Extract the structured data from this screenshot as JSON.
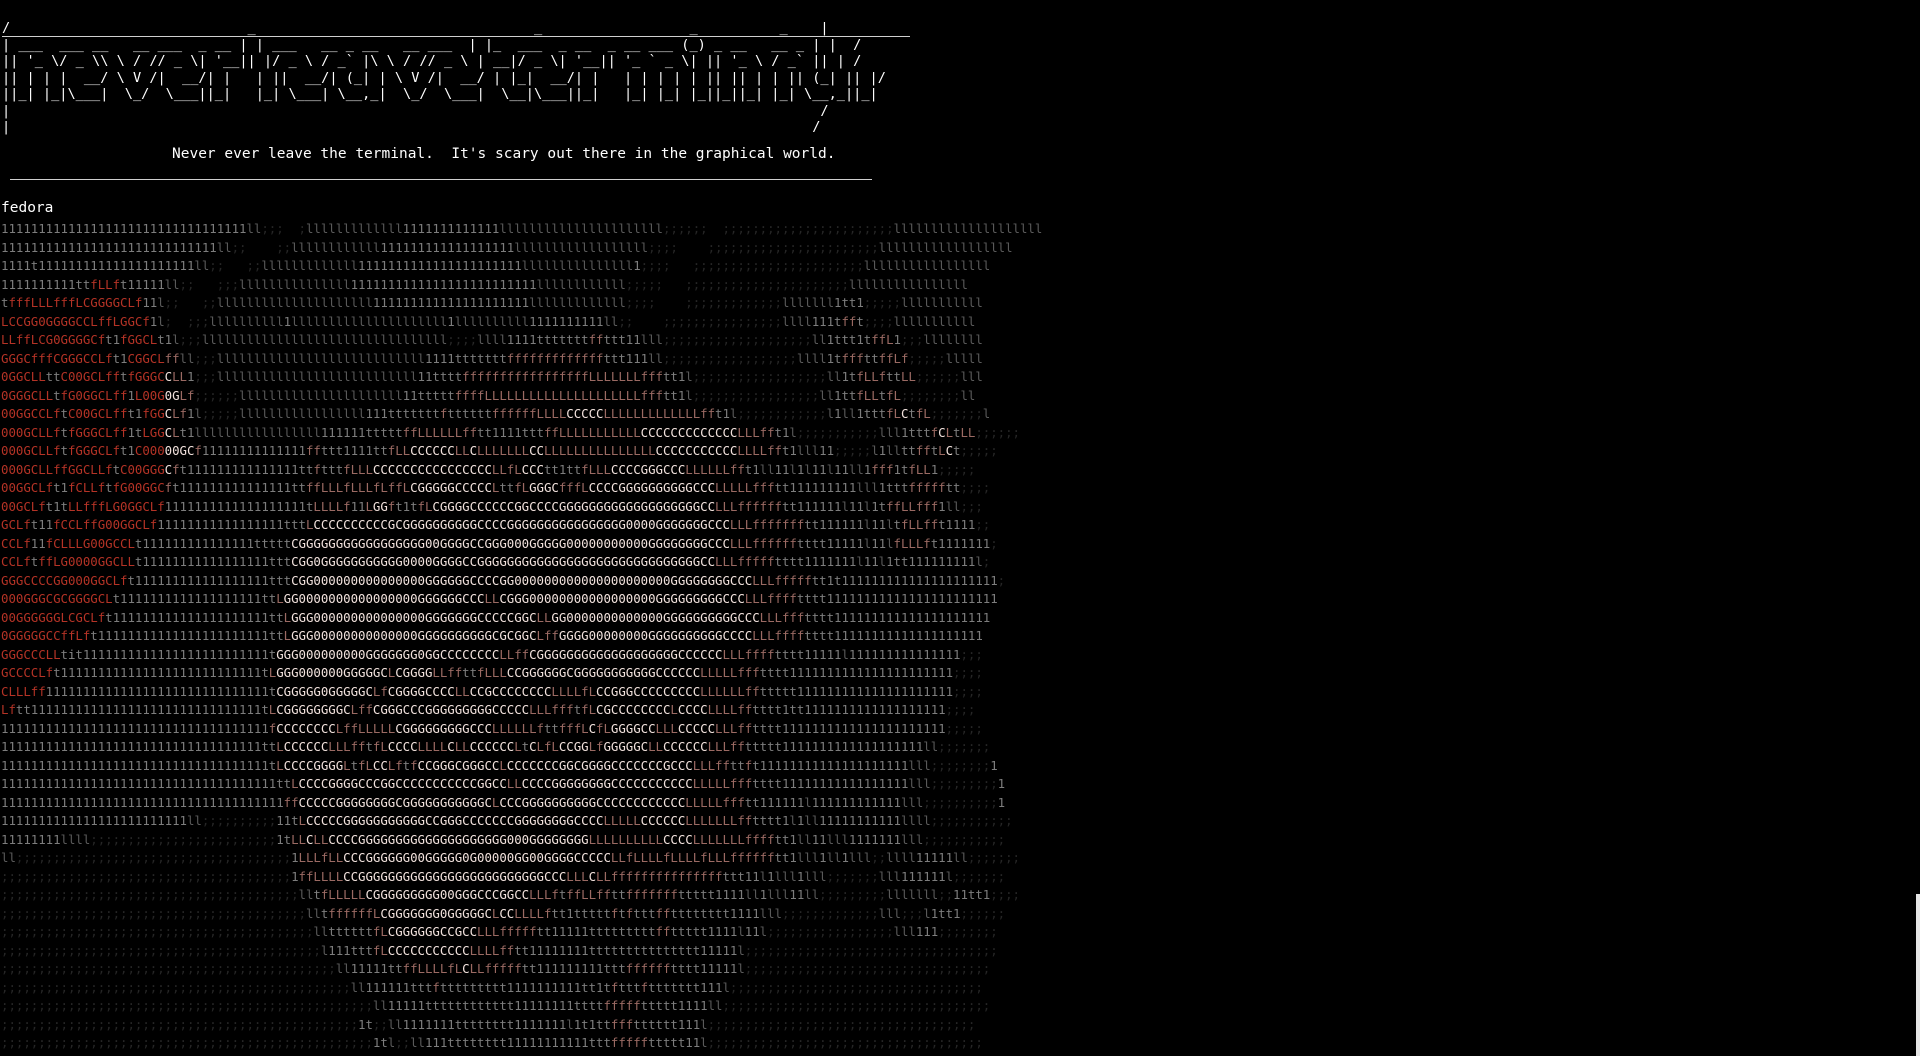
{
  "banner": {
    "art_lines": [
      " ____________________________________________________________________________________________________ ",
      "/                             _                                  _                  _          _    |",
      "| ___  ___ __   __ ___  _ __ | | ___   __ _ __   __ ___  | |_  ___  _ __  _ __ ___ (_) _ __   __ _ | |  /",
      "|| '_ \\/ _ \\\\ \\ / // _ \\| '__|| |/ _ \\ / _` |\\ \\ / // _ \\ | __|/ _ \\| '__|| '_ ` _ \\| || '_ \\ / _` || | / ",
      "|| | | |  __/ \\ V /|  __/| |   | ||  __/| (_| | \\ V /|  __/ | |_|  __/| |   | | | | | || || | | || (_| || |/  ",
      "||_| |_|\\___|  \\_/  \\___||_|   |_| \\___| \\__,_|  \\_/  \\___|  \\__|\\___||_|   |_| |_| |_||_||_| |_| \\__,_||_|   ",
      "|                                                                                                   /   ",
      "|                                                                                                  /    ",
      "|__________________________________________________________________________________________________/     "
    ],
    "tagline": "Never ever leave the terminal.  It's scary out there in the graphical world."
  },
  "hostname": "fedora",
  "ascii_art": {
    "description_free": true,
    "palette": {
      "bright": "#f2e2dd",
      "red": "#b53326",
      "dim": "#5a5a5a",
      "faint": "#262626"
    },
    "rows": [
      "111111111111111111111111111111111ll;;;  ;lllllllllllll1111111111111llllllllllllllllllllll;;;;;;  ;;;;;;;;;;;;;;;;;;;;;;;llllllllllllllllllll",
      "11111111111111111111111111111ll;;    ;;llllllllllll111111111111111111llllllllllllllllll;;;;    ;;;;;;;;;;;;;;;;;;;;;;;llllllllllllllllll",
      "1111t111111111111111111111ll;;   ;;lllllllllllll1111111111111111111111lllllllllllllll1;;;;   ;;;;;;;;;;;;;;;;;;;;;;;lllllllllllllllll",
      "1111111111ttfLLft11111ll;;   ;;;lllllllllllllll1111111111111111111111111llllllllllll;;;;;   ;;;;;;;;;;;;;;;;;;;;;;llllllllllllllll",
      "tfffLLLfffLCGGGGCLf11l;;   ;;lllllllllllllllllllll111111111111111111111lllllllllllll;;;;    ;;;;;;;;;;;;;lllllll1tt1;;;;;lllllllllll",
      "LCCGG0GGGGCCLffLGGCf1l;  ;;;llllllllll1lllllllllllllllllllll1llllllllll1111111111ll;;    ;;;;;;;;;;;;;;;;llll111tfft;;;;lllllllllll",
      "LLffLCG0GGGGCft1fGGCLt1l;;;lllllllllllllllllllllllllllllllll;;;;llll1111tttttttffttt11lll;;;;;;;;;;;;;;;;;;;;ll1ttt1tffL1;;;llllllll",
      "GGGCfffCGGGCCLft1CGGCLffll;;;llllllllllllllllllllllllllll1111tttttttfffffffffffffttt111ll;;;;;;;;;;;;;;;;;;llll1tfffttffLf;;;;;lllll",
      "0GGCLLttC00GCLfftfGGGCCLL1;;;lllllllllllllllllllllllllll11ttttfffffffffffffffffLLLLLLLffftt1l;;;;;;;;;;;;;;;;;;ll1tfLLfttLL;;;;;;lll",
      "0GGGCLLtfG0GGCLff1L00G0GLf;;;;;;llllllllllllllllllllll11tttttffffLLLLLLLLLLLLLLLLLLLLLffftt1l;;;;;;;;;;;;;;;;;ll1ttfLLtfL;;;;;;;;ll",
      "00GGCCLftC00GCLfft1fGGCLf1l;;;;;lllllllllllllllll111tttttttfttttttffffffLLLLCCCCCLLLLLLLLLLLLLfft1l;;;;;;;;;;;;l1ll1tttfLCtfL;;;;;;;l",
      "000GCLLftfGGGCLff1tLGGCLt1lllllllllllllllll111111tttttffLLLLLLfftt1111tttffLLLLLLLLLLLCCCCCCCCCCCCCLLLfft1l;;;;;;;;;;;lll1tttfCLtLL;;;;;;",
      "000GCLLftfGGGCLft1C00000GCf11111111111111ffttt1111ttfLLCCCCCCLLCLLLLLLLCCLLLLLLLLLLLLLLLCCCCCCCCCCCLLLLfft1lll11;;;;;l1llttfftLCt;;;;;",
      "000GCLLffGGCLLftC00GGGCft111111111111111ttftttfLLLCCCCCCCCCCCCCCCCLLfLCCCtt1ttfLLLCCCCGGGCCCLLLLLLfft1ll11l1l11l11ll1fff1tfLL1;;;;;",
      "00GGCLft1fCLLftfG00GGCft111111111111111ttffLLLfLLLfLffLCGGGGGCCCCCLttfLGGGCfffLCCCCGGGGGGGGGGCCCLLLLLffftt111111111lll1tttffffftt;;;;",
      "00GCLft1tLLfffLG0GGCLf1111111111111111111tLLLLf11LGGft1tfLCGGGGCCCCCCGGCCCCGGGGGGGGGGGGGGGGGGGCCLLLfffffftt111111l11l1tffLLfff1ll;;;",
      "GCLft11fCCLffG00GGCLf11111111111111111tttLCCCCCCCCCCGCGGGGGGGGGGCCCCGGGGGGGGGGGGGGGG0000GGGGGGGCCCLLLffffffftt111111l11ltfLLfft1111;;",
      "CCLf11fCLLLG00GCCLt111111111111111tttttCGGGGGGGGGGGGGGGGG00GGGGCCGGG000GGGGG00000000000GGGGGGGGCCCLLLfffffftttt11111l11lfLLLft1111111;",
      "CCLftffLG0000GGCLLt11111111111111111tttCGG0GGGGGGGGGGG0000GGGGCCGGGGGGGGGGGGGGGGGGGGGGGGGGGGGGCCLLLffffftttt1111111l11l1tt111111111l;",
      "GGGCCCCGG000GGCLft111111111111111111tttCGG000000000000000GGGGGGCCCCGG000000000000000000000GGGGGGGGCCCLLLffffftt1t111111111111111111111;",
      "000GGGCGCGGGGCLt1111111111111111111ttLGG0000000000000000GGGGGGCCCLLCGGG00000000000000000GGGGGGGGGCCCLLLfffftttt11111111111111111111111",
      "00GGGGGGLCGCLft111111111111111111111ttLGGG000000000000000GGGGGGGCCCCCGGCLLGG0000000000000GGGGGGGGGGCCCLLLffftttt111111111111111111111",
      "0GGGGGCCffLft11111111111111111111111ttLGGG00000000000000GGGGGGGGGGCGCGGCLffGGGG00000000GGGGGGGGGGCCCCLLLfffftttt11111111111111111111",
      "GGGCCCLLtit1111111111111111111111111tGGG000000000GGGGGGG0GGCCCCCCCCLLffCGGGGGGGGGGGGGGGGGGGCCCCCCLLLfffftttt11111l111111111111111;;;",
      "GCCCCLft111111111111111111111111111tLGGG000000GGGGGCLCGGGGLLffttfLLLCCGGGGGGCGGGGGGGGGGGCCCCCCLLLLLffftttt1111111111111111111111;;;;",
      "CLLLff111111111111111111111111111111tCGGGGG0GGGGGCLfCGGGGCCCCLLCCGCCCCCCCCLLLLfLCCGGGCCCCCCCCCLLLLLLffttttt111111111111111111111;;;;",
      "Lftt1111111111111111111111111111111tLCGGGGGGGGCLffCGGGCCCGGGGGGGGGCCCCCLLLffftfLCGCCCCCCCCLCCCCLLLLfftttt1tt1111111111111111111;;;;",
      "111111111111111111111111111111111111fCCCCCCCCLffLLLLLCGGGGGGGGGCCCLLLLLLfttfffLCfLGGGGCCLLLCCCCCLLLfftttt1111111111111111111111;;;;;",
      "11111111111111111111111111111111111ttLCCCCCCLLLfftfLCCCCLLLLCLLCCCCCCLtCLfLCCGGLfGGGGGCLLCCCCCCLLLffttttt1111111111111111111ll;;;;;;;",
      "111111111111111111111111111111111111tLCCCCGGGGLtfLCCLftfCCGGGCGGGCCLCCCCCCCGGCGGGGCCCCCCCGCCCLLLffttft11111111111111111111lll;;;;;;;;1",
      "1111111111111111111111111111111111111ttLCCCCGGGGCCCGGCCCCCCCCCCCGGCCLLCCCCGGGGGGGGCCCCCCCCCCCLLLLLffftttt11111111111111111lll;;;;;;;;;1",
      "11111111111111111111111111111111111111ffCCCCCGGGGGGGGCGGGGGGGGGGGCLCCCGGGGGGGGGGCCCCCCCCCCCCLLLLLffftt111111l111111111111lll;;;;;;;;;;1",
      "1111111111111111111111111ll;;;;;;;;;;11tLCCCCCGGGGGGGGGGGCCGGGCCCCCCCGGGGGGGGCCCCLLLLLCCCCCCLLLLLLLfftttt1l1ll11111111111llll;;;;;;;;;;;",
      "11111111llll;;;;;;;;;;;;;;;;;;;;;;;;;1tLLCLLCCCCGGGGGGGGGGGGGGGGGGGG000GGGGGGGGLLLLLLLLLLCCCCLLLLLLLfffftt1ll11lll1111111lll;;;;;;;;;;;",
      "ll;;;;;;;;;;;;;;;;;;;;;;;;;;;;;;;;;;;;;1LLLfLLCCCGGGGGG00GGGGG0G00000GG00GGGGCCCCCLLfLLLLfLLLLfLLLfffffftt1lll1ll1lll;;llll11111ll;;;;;;;",
      ";;;;;;;;;;;;;;;;;;;;;;;;;;;;;;;;;;;;;;;1ffLLLLCCGGGGGGGGGGGGGGGGGGGGGGGGGCCCLLLCLLfffffffffffffffttt11l1lll1lll;;;;;;;lll111111l;;;;;;;",
      ";;;;;;;;;;;;;;;;;;;;;;;;;;;;;;;;;;;;;;;;lltfLLLLLCGGGGGGGGG00GGGCCCGGCCLLLftffLLffttfffffffttttt1111ll1lll11ll;;;;;;;;;lllllll;;11tt1;;;;",
      ";;;;;;;;;;;;;;;;;;;;;;;;;;;;;;;;;;;;;;;;;lltffffffLCGGGGGGG0GGGGGCLCCLLLLftt1tttttftftttfftttttttt1111lll;;;;;;;;;;;;;lll;;;l1tt1;;;;;;",
      ";;;;;;;;;;;;;;;;;;;;;;;;;;;;;;;;;;;;;;;;;;llttttttfLCGGGGGGCCGCCLLLffffftt11111tttttttttffttttt1111l11l;;;;;;;;;;;;;;;;;lll111;;;;;;;;",
      ";;;;;;;;;;;;;;;;;;;;;;;;;;;;;;;;;;;;;;;;;;;l111tttfLCCCCCCCCCCCLLLLfftt11111111ttttttttttttttt11111l;;;;;;;;;;;;;;;;;;;;;;;;;;;;;;;;;;",
      ";;;;;;;;;;;;;;;;;;;;;;;;;;;;;;;;;;;;;;;;;;;;;ll11111ttffLLLLfLCLLffffftt111111111tttfffffftttt11111l;;;;;;;;;;;;;;;;;;;;;;;;;;;;;;;;;",
      ";;;;;;;;;;;;;;;;;;;;;;;;;;;;;;;;;;;;;;;;;;;;;;;ll111111tttfttttttttt1111111111tt1tftttfttttttt111l;;;;;;;;;;;;;;;;;;;;;;;;;;;;;;;;;;",
      ";;;;;;;;;;;;;;;;;;;;;;;;;;;;;;;;;;;;;;;;;;;;;;;;;;ll11111tttttttttttt11111111ttttfffffttttt1111ll;;;;;;;;;;;;;;;;;;;;;;;;;;;;;;;;;;;;",
      ";;;;;;;;;;;;;;;;;;;;;;;;;;;;;;;;;;;;;;;;;;;;;;;;1t;;ll1111111tttttttt1111111l1t1ttffftttttt111l;;;;;;;;;;;;;;;;;;;;;;;;;;;;;;;;;;;;",
      ";;;;;;;;;;;;;;;;;;;;;;;;;;;;;;;;;;;;;;;;;;;;;;;;;;1tl;;ll111tttttttt11111111111tttfffffttttt11l;;;;;;;;;;;;;;;;;;;;;;;;;;;;;;;;;;;;;",
      ";;;;;;;;;;;;;;;;;;;;;;;;;;;;;;;;;;;;;;;;;;;;;;;;;;;;;;;;;;;111tttttfffttffttttttttffttttttt1111ll;;;;;;;;;;;;;;;;;;;;;;;;;;;;;;;;;;;;",
      ";;;;;;;;;;;;;;;;;;;;;;;;;;;;;;;;;;;;;;;;;;;;;;;;;;;;;;;;;;;;;;11tffLLLLLLfLffLfttftttttt1111111;;;;;;;;;;;;;;;;;;;;;;;;;;;;;;;;;;;;"
    ]
  }
}
